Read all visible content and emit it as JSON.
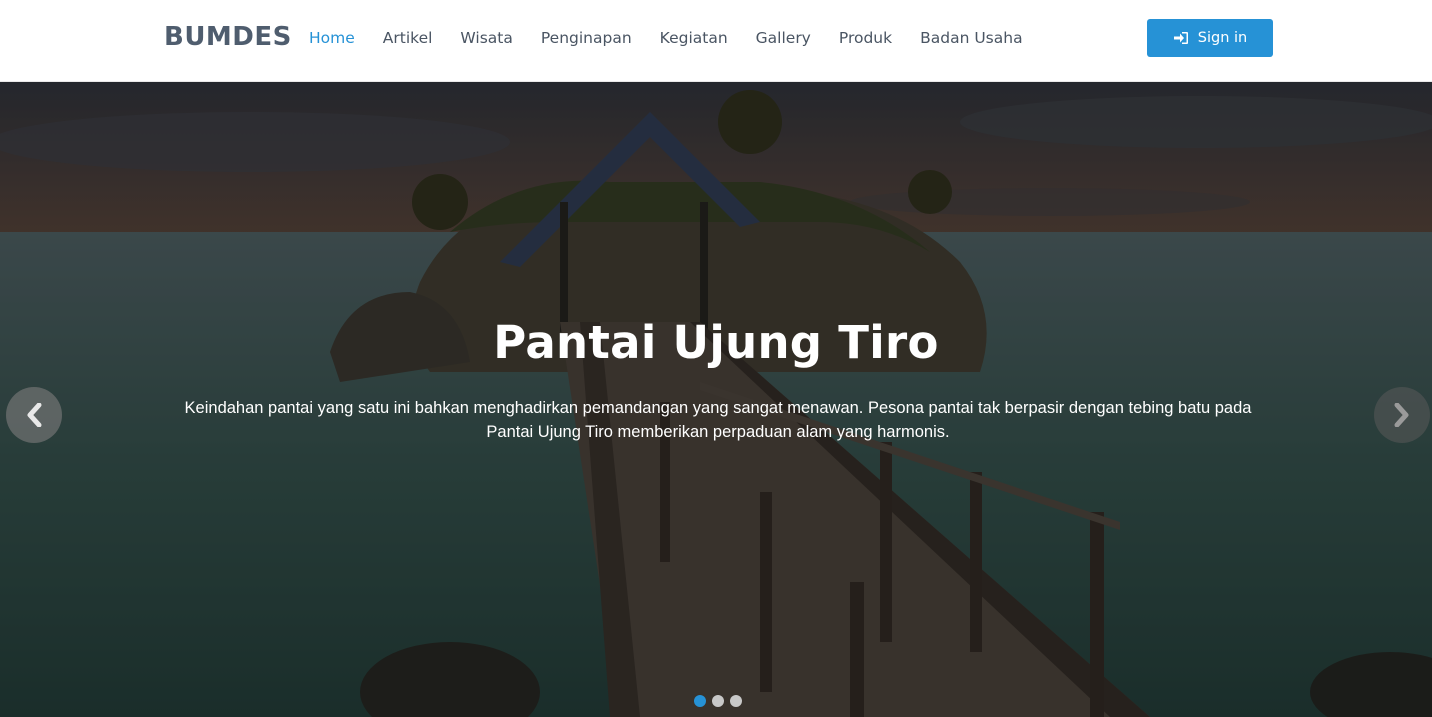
{
  "brand": "BUMDES",
  "nav": {
    "items": [
      "Home",
      "Artikel",
      "Wisata",
      "Penginapan",
      "Kegiatan",
      "Gallery",
      "Produk",
      "Badan Usaha"
    ],
    "active_index": 0
  },
  "signin": {
    "label": "Sign in",
    "icon": "sign-in-icon"
  },
  "slider": {
    "title": "Pantai Ujung Tiro",
    "description": "Keindahan pantai yang satu ini bahkan menghadirkan pemandangan yang sangat menawan. Pesona pantai tak berpasir dengan tebing batu pada Pantai Ujung Tiro memberikan perpaduan alam yang harmonis.",
    "slide_count": 3,
    "active_slide": 0,
    "prev_icon": "chevron-left-icon",
    "next_icon": "chevron-right-icon"
  },
  "colors": {
    "accent": "#2692d6",
    "nav_text": "#4a5563",
    "brand": "#4f5d6e"
  }
}
